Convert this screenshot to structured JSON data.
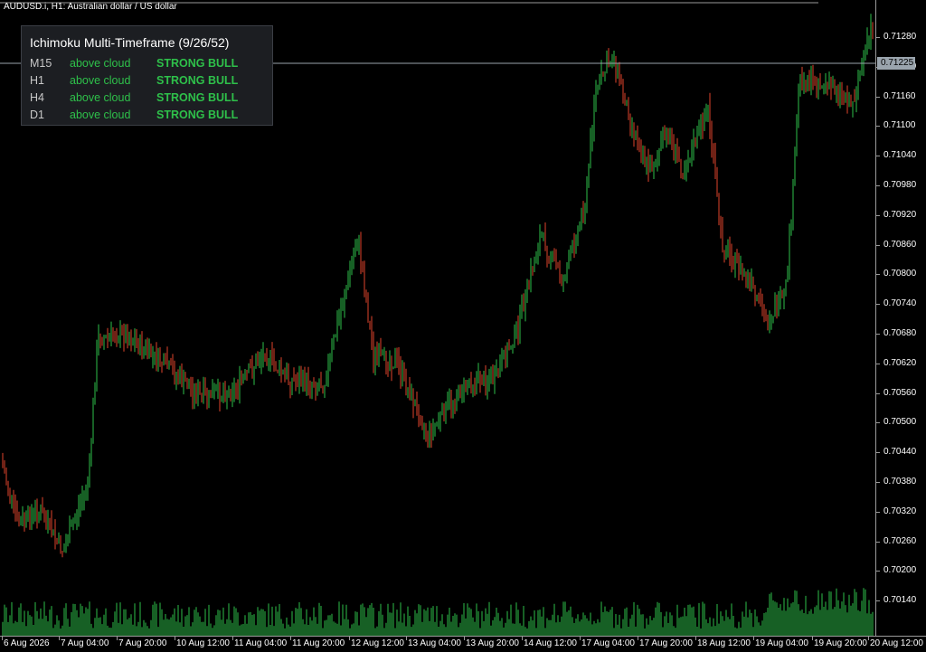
{
  "header": {
    "symbol": "AUDUSD.i, H1:  Australian dollar / US dollar"
  },
  "panel": {
    "title": "Ichimoku Multi-Timeframe (9/26/52)",
    "rows": [
      {
        "tf": "M15",
        "position": "above cloud",
        "signal": "STRONG BULL"
      },
      {
        "tf": "H1",
        "position": "above cloud",
        "signal": "STRONG BULL"
      },
      {
        "tf": "H4",
        "position": "above cloud",
        "signal": "STRONG BULL"
      },
      {
        "tf": "D1",
        "position": "above cloud",
        "signal": "STRONG BULL"
      }
    ]
  },
  "price_axis": {
    "labels": [
      "0.71280",
      "0.71220",
      "0.71160",
      "0.71100",
      "0.71040",
      "0.70980",
      "0.70920",
      "0.70860",
      "0.70800",
      "0.70740",
      "0.70680",
      "0.70620",
      "0.70560",
      "0.70500",
      "0.70440",
      "0.70380",
      "0.70320",
      "0.70260",
      "0.70200",
      "0.70140"
    ],
    "current_bid": "0.71225"
  },
  "time_axis": {
    "labels": [
      "6 Aug 2026",
      "7 Aug 04:00",
      "7 Aug 20:00",
      "10 Aug 12:00",
      "11 Aug 04:00",
      "11 Aug 20:00",
      "12 Aug 12:00",
      "13 Aug 04:00",
      "13 Aug 20:00",
      "14 Aug 12:00",
      "17 Aug 04:00",
      "17 Aug 20:00",
      "18 Aug 12:00",
      "19 Aug 04:00",
      "19 Aug 20:00",
      "20 Aug 12:00"
    ]
  },
  "colors": {
    "bull": "#2ec04a",
    "bear": "#e0452c",
    "volume": "#2ec04a",
    "background": "#000000",
    "grid": "#9a9a9a"
  }
}
